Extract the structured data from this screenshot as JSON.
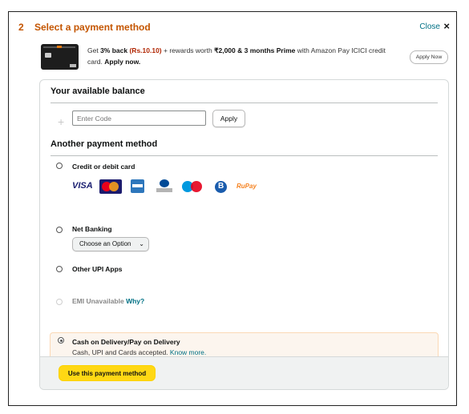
{
  "header": {
    "step_number": "2",
    "title": "Select a payment method",
    "close_label": "Close",
    "close_icon": "×"
  },
  "promo": {
    "text_prefix": "Get ",
    "cashback": "3% back",
    "amount": "(Rs.10.10)",
    "text_mid": " + rewards worth ",
    "rewards": "₹2,000 & 3 months Prime",
    "text_suffix": " with Amazon Pay ICICI credit card. ",
    "apply_now_bold": "Apply now.",
    "apply_now_button": "Apply Now"
  },
  "balance": {
    "title": "Your available balance",
    "code_placeholder": "Enter Code",
    "apply_label": "Apply"
  },
  "another": {
    "title": "Another payment method",
    "options": {
      "card": {
        "label": "Credit or debit card"
      },
      "netbanking": {
        "label": "Net Banking",
        "select_value": "Choose an Option"
      },
      "upi": {
        "label": "Other UPI Apps"
      },
      "emi": {
        "label": "EMI Unavailable",
        "why": "Why?"
      },
      "cod": {
        "label": "Cash on Delivery/Pay on Delivery",
        "sub": "Cash, UPI and Cards accepted.",
        "know_more": "Know more."
      }
    },
    "brands": {
      "visa": "VISA",
      "rupay_a": "RuPay",
      "rupay_b": "›"
    }
  },
  "footer": {
    "use_button": "Use this payment method"
  },
  "colors": {
    "title_orange": "#c45500",
    "link_teal": "#007185",
    "button_yellow": "#ffd814"
  }
}
